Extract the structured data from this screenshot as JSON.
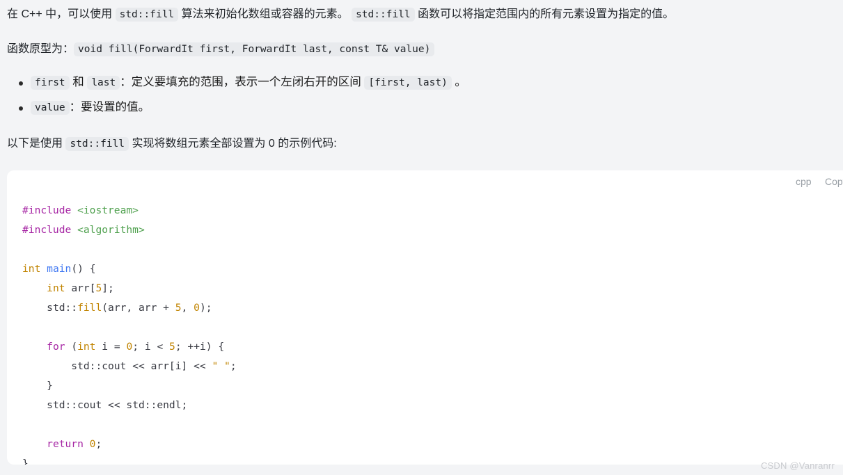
{
  "page": {
    "background": "#f3f4f6",
    "watermark": "CSDN @Vanranrr"
  },
  "paragraphs": {
    "intro": {
      "seg1": "在 C++ 中，可以使用 ",
      "code1": "std::fill",
      "seg2": " 算法来初始化数组或容器的元素。 ",
      "code2": "std::fill",
      "seg3": " 函数可以将指定范围内的所有元素设置为指定的值。"
    },
    "prototype": {
      "label": "函数原型为：",
      "code": "void fill(ForwardIt first, ForwardIt last, const T& value)"
    },
    "example_lead": {
      "seg1": "以下是使用 ",
      "code": "std::fill",
      "seg2": " 实现将数组元素全部设置为 0 的示例代码:"
    }
  },
  "bullets": [
    {
      "code1": "first",
      "mid": " 和 ",
      "code2": "last",
      "seg1": "：定义要填充的范围，表示一个左闭右开的区间 ",
      "code3": "[first, last)",
      "seg2": " 。"
    },
    {
      "code1": "value",
      "seg1": "：要设置的值。"
    }
  ],
  "code_block": {
    "language_label": "cpp",
    "copy_label": "Copy",
    "background": "#ffffff",
    "source": "#include <iostream>\n#include <algorithm>\n\nint main() {\n    int arr[5];\n    std::fill(arr, arr + 5, 0);\n\n    for (int i = 0; i < 5; ++i) {\n        std::cout << arr[i] << \" \";\n    }\n    std::cout << std::endl;\n\n    return 0;\n}",
    "lines": [
      "#include <iostream>",
      "#include <algorithm>",
      "",
      "int main() {",
      "    int arr[5];",
      "    std::fill(arr, arr + 5, 0);",
      "",
      "    for (int i = 0; i < 5; ++i) {",
      "        std::cout << arr[i] << \" \";",
      "    }",
      "    std::cout << std::endl;",
      "",
      "    return 0;",
      "}"
    ],
    "colors": {
      "preprocessor": "#a626a4",
      "string": "#50a14f",
      "keyword": "#a626a4",
      "type": "#c18401",
      "function": "#4078f2",
      "number": "#c18401",
      "plain": "#383a42"
    }
  }
}
